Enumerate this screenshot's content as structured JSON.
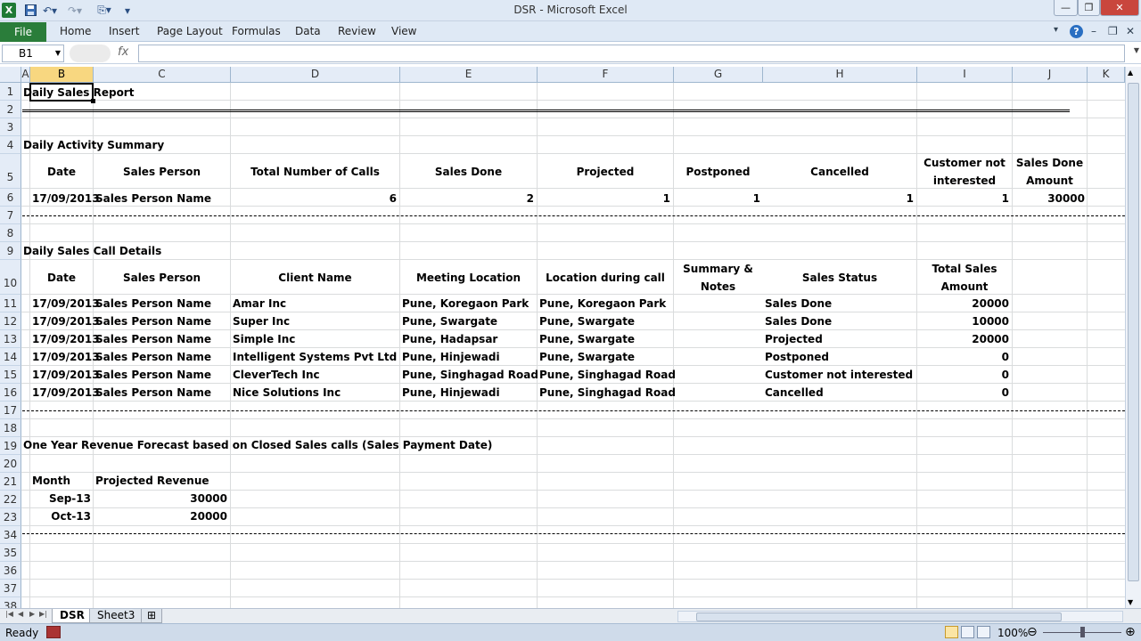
{
  "window": {
    "title": "DSR - Microsoft Excel",
    "qat_icons": [
      "excel-logo-icon",
      "save-icon",
      "undo-icon",
      "redo-icon",
      "customize-icon"
    ],
    "controls": [
      "minimize",
      "maximize",
      "close"
    ]
  },
  "ribbon": {
    "file_label": "File",
    "tabs": [
      "Home",
      "Insert",
      "Page Layout",
      "Formulas",
      "Data",
      "Review",
      "View"
    ],
    "accent": "#2a7d3a"
  },
  "formula_bar": {
    "name_box": "B1",
    "fx": "fx",
    "formula": ""
  },
  "columns": [
    "A",
    "B",
    "C",
    "D",
    "E",
    "F",
    "G",
    "H",
    "I",
    "J",
    "K"
  ],
  "selected_cell": "B1",
  "rows": [
    "1",
    "2",
    "3",
    "4",
    "5",
    "6",
    "7",
    "8",
    "9",
    "10",
    "11",
    "12",
    "13",
    "14",
    "15",
    "16",
    "17",
    "18",
    "19",
    "20",
    "21",
    "22",
    "23",
    "34",
    "35",
    "36",
    "37",
    "38"
  ],
  "sheet": {
    "title": "Daily Sales Report",
    "summary": {
      "heading": "Daily Activity Summary",
      "headers": {
        "date": "Date",
        "sales_person": "Sales Person",
        "total_calls": "Total Number of Calls",
        "sales_done": "Sales Done",
        "projected": "Projected",
        "postponed": "Postponed",
        "cancelled": "Cancelled",
        "not_interested_1": "Customer not",
        "not_interested_2": "interested",
        "amount_1": "Sales Done",
        "amount_2": "Amount"
      },
      "row": {
        "date": "17/09/2013",
        "sales_person": "Sales Person Name",
        "total_calls": "6",
        "sales_done": "2",
        "projected": "1",
        "postponed": "1",
        "cancelled": "1",
        "not_interested": "1",
        "amount": "30000"
      }
    },
    "calls": {
      "heading": "Daily Sales Call Details",
      "headers": {
        "date": "Date",
        "sales_person": "Sales Person",
        "client": "Client Name",
        "meeting_location": "Meeting Location",
        "location_during_call": "Location during call",
        "summary_1": "Summary &",
        "summary_2": "Notes",
        "status": "Sales Status",
        "amount_1": "Total Sales",
        "amount_2": "Amount"
      },
      "rows": [
        {
          "date": "17/09/2013",
          "person": "Sales Person Name",
          "client": "Amar Inc",
          "meeting": "Pune, Koregaon Park",
          "location": "Pune, Koregaon Park",
          "status": "Sales Done",
          "amount": "20000"
        },
        {
          "date": "17/09/2013",
          "person": "Sales Person Name",
          "client": "Super Inc",
          "meeting": "Pune, Swargate",
          "location": "Pune, Swargate",
          "status": "Sales Done",
          "amount": "10000"
        },
        {
          "date": "17/09/2013",
          "person": "Sales Person Name",
          "client": "Simple Inc",
          "meeting": "Pune, Hadapsar",
          "location": "Pune, Swargate",
          "status": "Projected",
          "amount": "20000"
        },
        {
          "date": "17/09/2013",
          "person": "Sales Person Name",
          "client": "Intelligent Systems Pvt Ltd",
          "meeting": "Pune, Hinjewadi",
          "location": "Pune, Swargate",
          "status": "Postponed",
          "amount": "0"
        },
        {
          "date": "17/09/2013",
          "person": "Sales Person Name",
          "client": "CleverTech Inc",
          "meeting": "Pune, Singhagad Road",
          "location": "Pune, Singhagad Road",
          "status": "Customer not interested",
          "amount": "0"
        },
        {
          "date": "17/09/2013",
          "person": "Sales Person Name",
          "client": "Nice Solutions Inc",
          "meeting": "Pune, Hinjewadi",
          "location": "Pune, Singhagad Road",
          "status": "Cancelled",
          "amount": "0"
        }
      ]
    },
    "forecast": {
      "heading": "One Year Revenue Forecast based on Closed Sales calls (Sales Payment Date)",
      "headers": {
        "month": "Month",
        "revenue": "Projected Revenue"
      },
      "rows": [
        {
          "month": "Sep-13",
          "revenue": "30000"
        },
        {
          "month": "Oct-13",
          "revenue": "20000"
        }
      ]
    }
  },
  "sheet_tabs": [
    "DSR",
    "Sheet3"
  ],
  "active_sheet": "DSR",
  "status": {
    "ready": "Ready",
    "zoom": "100%",
    "zoom_level_percent": 100
  }
}
